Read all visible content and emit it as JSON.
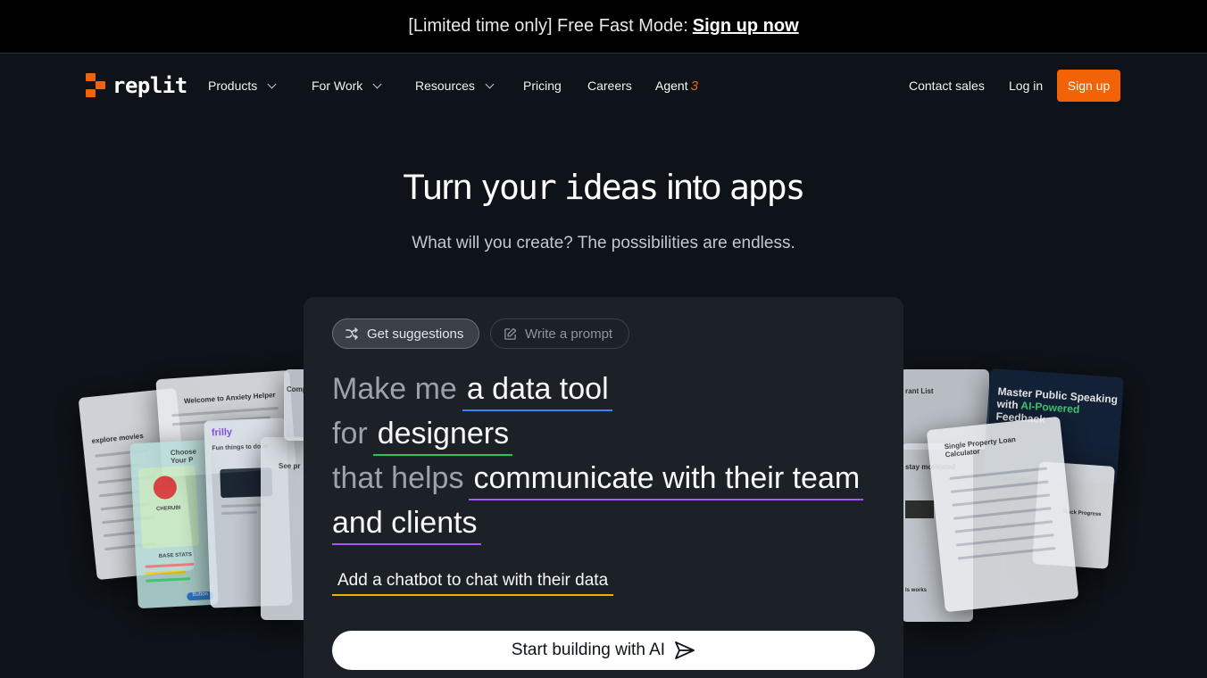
{
  "banner": {
    "text": "[Limited time only] Free Fast Mode:",
    "link": "Sign up now"
  },
  "nav": {
    "logo": "replit",
    "items": [
      {
        "label": "Products",
        "dropdown": true
      },
      {
        "label": "For Work",
        "dropdown": true
      },
      {
        "label": "Resources",
        "dropdown": true
      },
      {
        "label": "Pricing",
        "dropdown": false
      },
      {
        "label": "Careers",
        "dropdown": false
      },
      {
        "label": "Agent",
        "suffix": "3"
      }
    ],
    "contact": "Contact sales",
    "login": "Log in",
    "signup": "Sign up",
    "accent": "#f26207"
  },
  "hero": {
    "title_pre": "Turn ",
    "title_mono1": "your",
    "title_mid": " ",
    "title_mono2": "ideas",
    "title_mid2": " into ",
    "title_mono3": "apps",
    "subtitle": "What will you create? The possibilities are endless."
  },
  "panel": {
    "tabs": {
      "suggestions": "Get suggestions",
      "prompt": "Write a prompt"
    },
    "lines": {
      "l1_pre": "Make me",
      "l1_hl": "a data tool",
      "l2_pre": "for",
      "l2_hl": "designers",
      "l3_pre": "that helps",
      "l3_hl": "communicate with their team",
      "l4_hl": "and clients"
    },
    "chatbot": "Add a chatbot to chat with their data",
    "start_button": "Start building with AI"
  },
  "collage": {
    "left": {
      "movies": "explore movies",
      "anxiety": "Welcome to Anxiety Helper",
      "frilly": "frilly",
      "choose": "Choose Your P",
      "fun": "Fun things to do in",
      "see": "See pr",
      "comp": "Comp",
      "cherubi": "CHERUBI",
      "base_stats": "BASE STATS",
      "button": "Button"
    },
    "right": {
      "grant": "rant List",
      "stay": "stay motivated",
      "loan": "Single Property Loan Calculator",
      "speaking": "Master Public Speaking with",
      "speaking_hl": "AI-Powered",
      "speaking_end": "Feedback",
      "track": "Track Progress",
      "works": "ls works"
    }
  }
}
